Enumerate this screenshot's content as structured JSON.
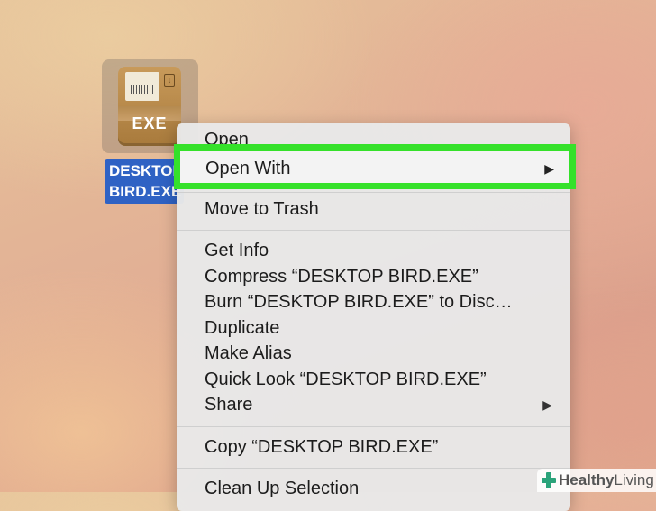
{
  "desktop_icon": {
    "badge": "EXE",
    "filename_line1": "DESKTOP",
    "filename_line2": "BIRD.EXE"
  },
  "context_menu": {
    "open": "Open",
    "open_with": "Open With",
    "move_to_trash": "Move to Trash",
    "get_info": "Get Info",
    "compress": "Compress “DESKTOP BIRD.EXE”",
    "burn": "Burn “DESKTOP BIRD.EXE” to Disc…",
    "duplicate": "Duplicate",
    "make_alias": "Make Alias",
    "quick_look": "Quick Look “DESKTOP BIRD.EXE”",
    "share": "Share",
    "copy": "Copy “DESKTOP BIRD.EXE”",
    "clean_up_selection": "Clean Up Selection",
    "submenu_arrow": "▶"
  },
  "highlight_color": "#35e12a",
  "watermark": {
    "brand_bold": "Healthy",
    "brand_light": "Living"
  }
}
